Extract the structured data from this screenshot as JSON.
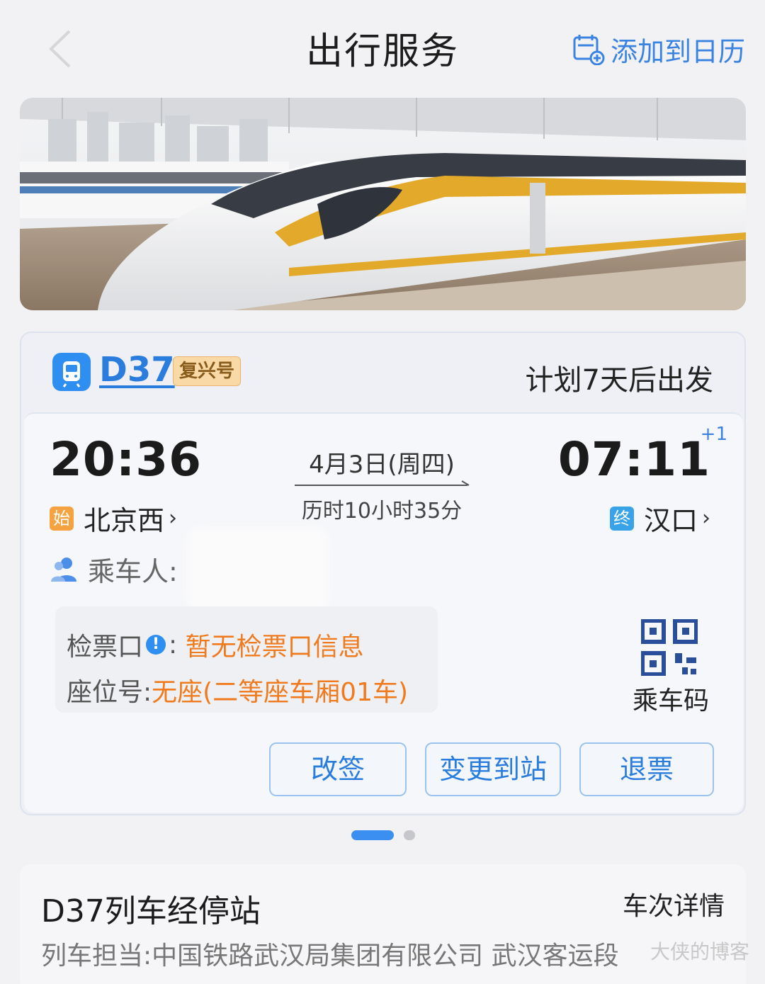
{
  "header": {
    "title": "出行服务",
    "add_calendar_label": "添加到日历",
    "back_icon": "chevron-left-icon",
    "calendar_icon": "calendar-add-icon"
  },
  "ticket": {
    "train_no": "D37",
    "train_type": "复兴号",
    "depart_plan": "计划7天后出发",
    "departure_time": "20:36",
    "arrival_time": "07:11",
    "arrival_day_offset": "+1",
    "date": "4月3日(周四)",
    "duration": "历时10小时35分",
    "departure_badge": "始",
    "departure_station": "北京西",
    "arrival_badge": "终",
    "arrival_station": "汉口",
    "passenger_label": "乘车人:",
    "gate_label": "检票口",
    "gate_value": "暂无检票口信息",
    "seat_label": "座位号:",
    "seat_value": "无座(二等座车厢01车)",
    "qr_label": "乘车码",
    "buttons": {
      "change": "改签",
      "change_station": "变更到站",
      "refund": "退票"
    }
  },
  "stops": {
    "title": "D37列车经停站",
    "detail_link": "车次详情",
    "operator": "列车担当:中国铁路武汉局集团有限公司 武汉客运段"
  },
  "watermark": "大侠的博客",
  "colors": {
    "accent": "#2a7ddd",
    "orange": "#f07a1e",
    "background": "#f2f2f4"
  }
}
